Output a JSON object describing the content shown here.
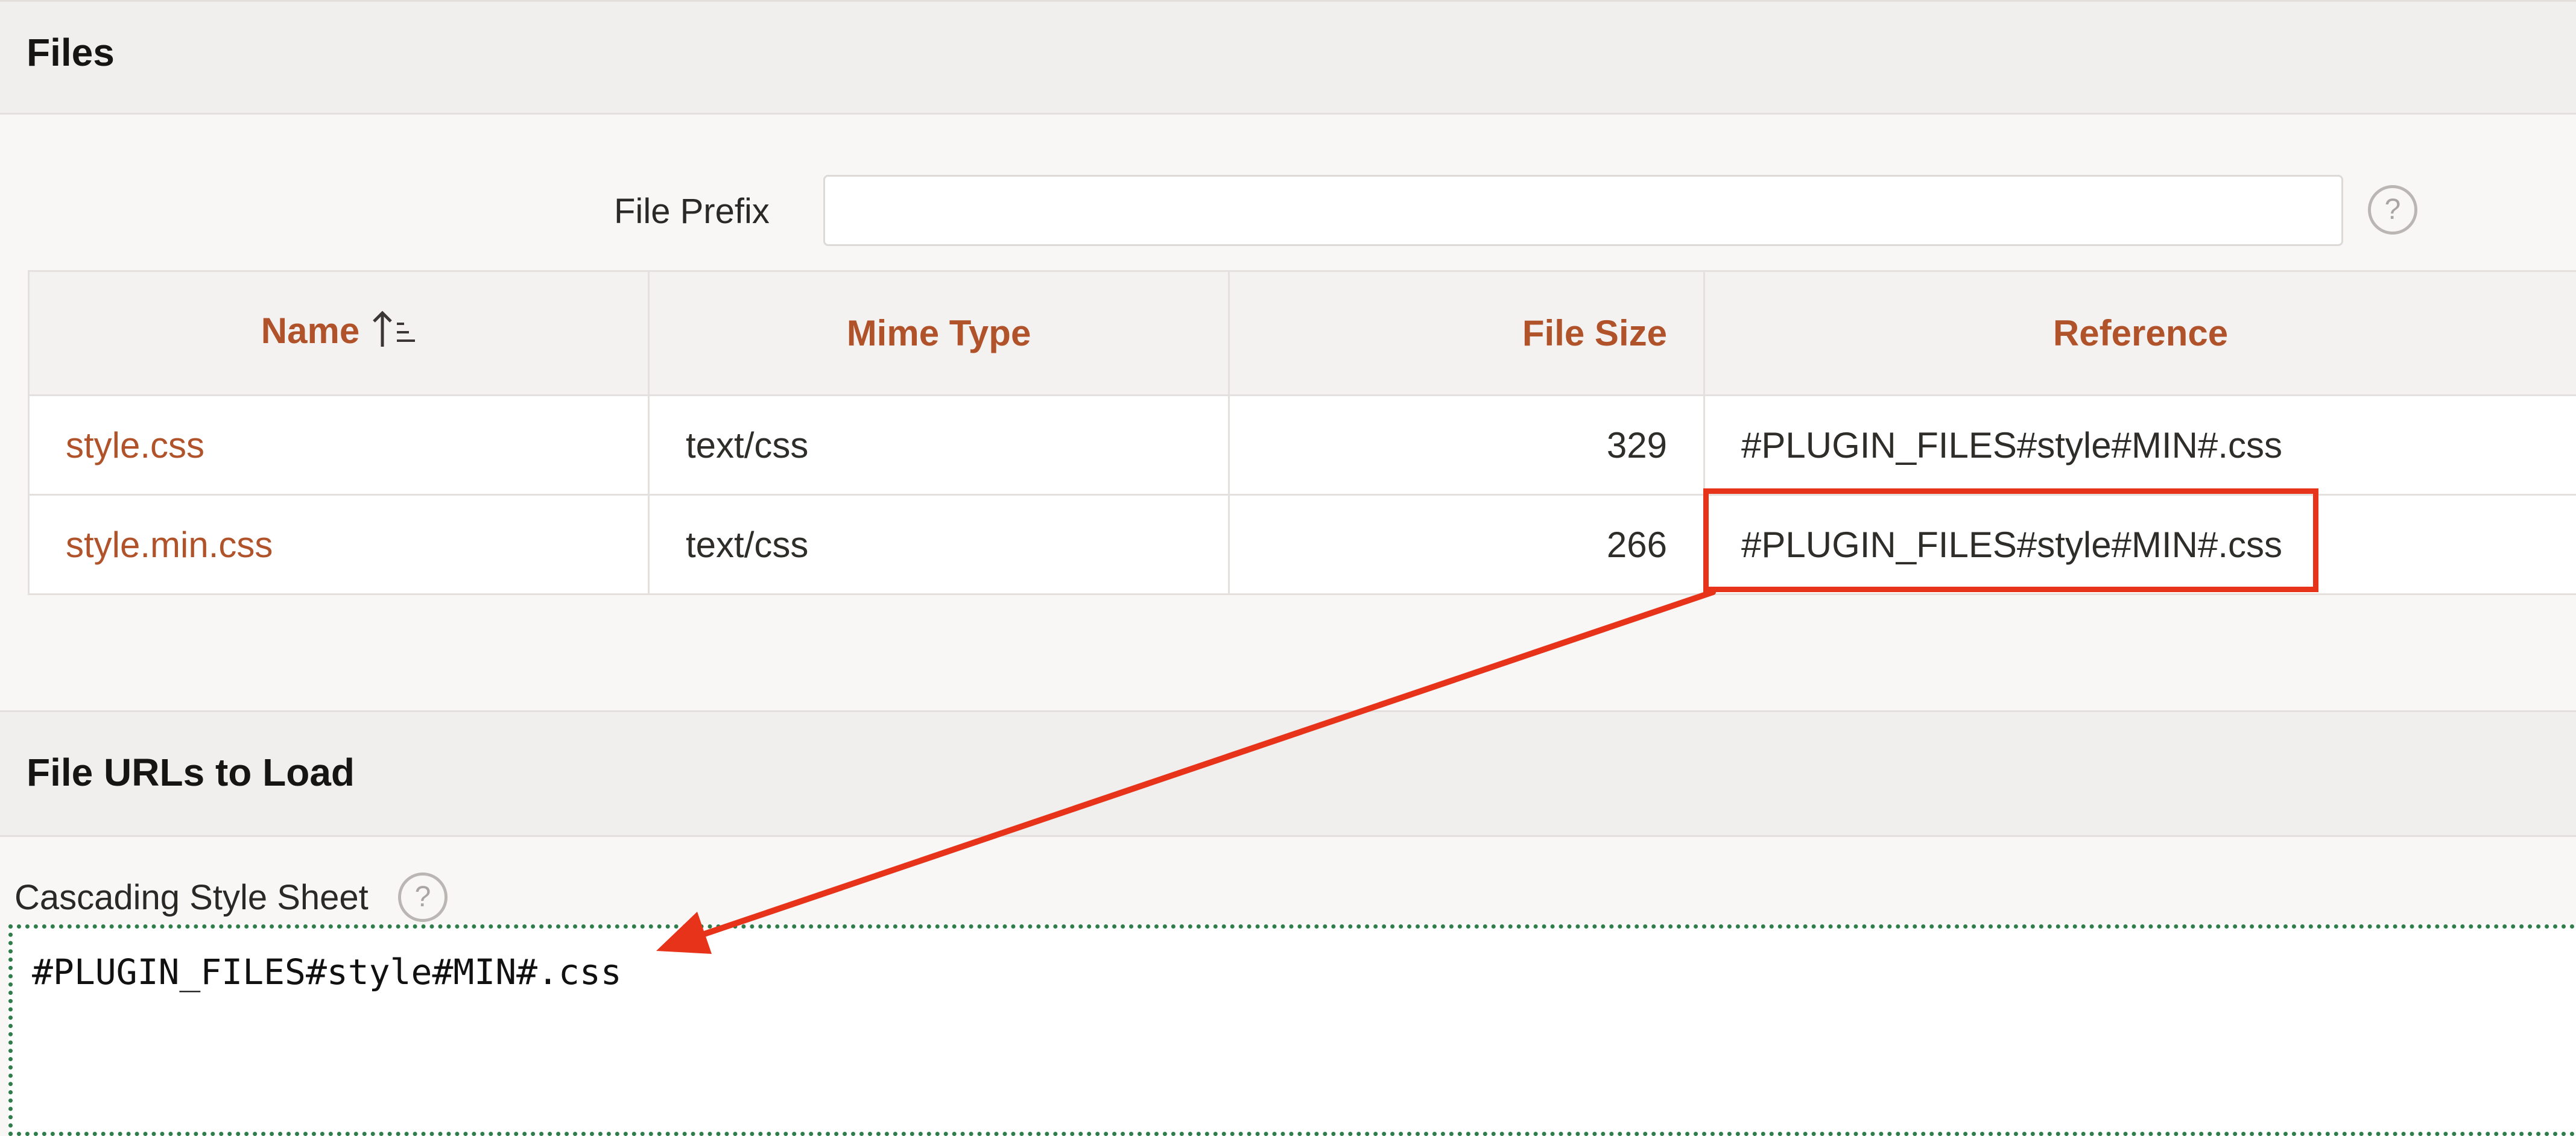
{
  "files_section": {
    "title": "Files",
    "file_prefix": {
      "label": "File Prefix",
      "value": "",
      "help": "?"
    },
    "table": {
      "headers": {
        "name": "Name",
        "mime_type": "Mime Type",
        "file_size": "File Size",
        "reference": "Reference"
      },
      "sort": {
        "column": "name",
        "direction": "ascending"
      },
      "rows": [
        {
          "name": "style.css",
          "mime_type": "text/css",
          "file_size": "329",
          "reference": "#PLUGIN_FILES#style#MIN#.css"
        },
        {
          "name": "style.min.css",
          "mime_type": "text/css",
          "file_size": "266",
          "reference": "#PLUGIN_FILES#style#MIN#.css"
        }
      ]
    }
  },
  "urls_section": {
    "title": "File URLs to Load",
    "css": {
      "label": "Cascading Style Sheet",
      "help": "?",
      "value": "#PLUGIN_FILES#style#MIN#.css"
    }
  },
  "annotation": {
    "highlight_color": "#e8331b",
    "arrow_icon": "arrow-icon"
  },
  "colors": {
    "accent": "#b0532a",
    "header_bg": "#f1efed",
    "focus_border": "#2e7d4a"
  }
}
